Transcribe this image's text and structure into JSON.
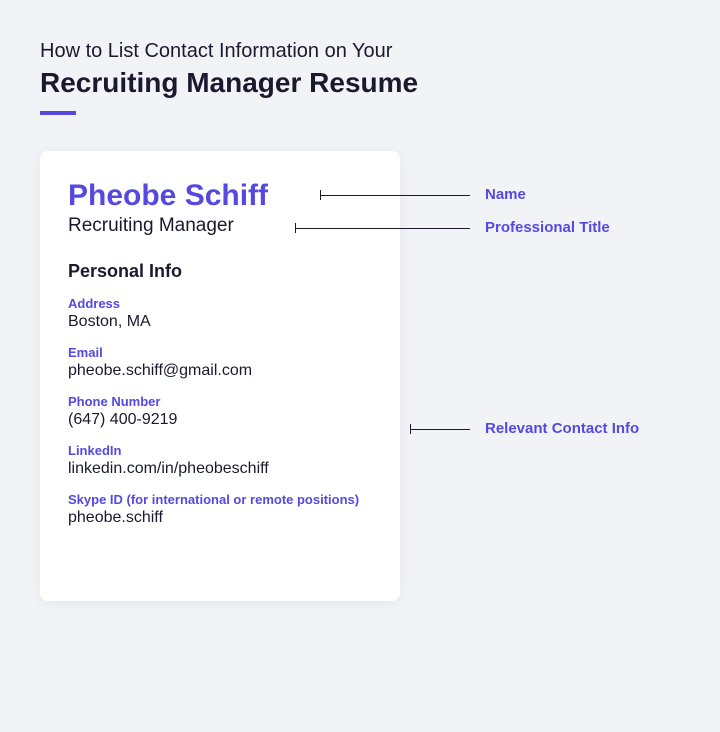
{
  "header": {
    "titleLight": "How to List Contact Information on Your",
    "titleBold": "Recruiting Manager Resume"
  },
  "resume": {
    "name": "Pheobe Schiff",
    "jobTitle": "Recruiting Manager",
    "sectionHeader": "Personal Info",
    "fields": {
      "address": {
        "label": "Address",
        "value": "Boston, MA"
      },
      "email": {
        "label": "Email",
        "value": "pheobe.schiff@gmail.com"
      },
      "phone": {
        "label": "Phone Number",
        "value": "(647) 400-9219"
      },
      "linkedin": {
        "label": "LinkedIn",
        "value": "linkedin.com/in/pheobeschiff"
      },
      "skype": {
        "label": "Skype ID (for international or remote positions)",
        "value": "pheobe.schiff"
      }
    }
  },
  "annotations": {
    "name": "Name",
    "title": "Professional Title",
    "contact": "Relevant Contact Info"
  }
}
